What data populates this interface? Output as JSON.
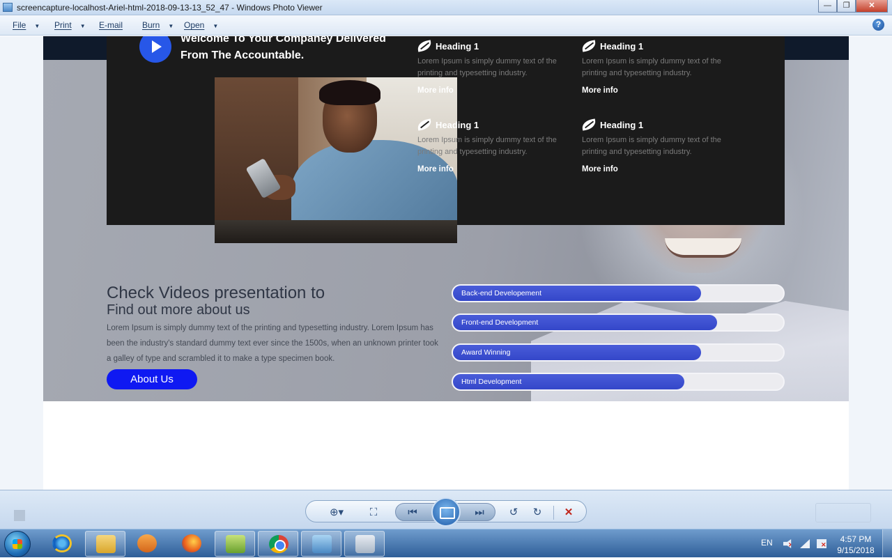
{
  "window": {
    "title": "screencapture-localhost-Ariel-html-2018-09-13-13_52_47 - Windows Photo Viewer",
    "minimize": "—",
    "restore": "❐",
    "close": "✕"
  },
  "menu": {
    "items": [
      "File",
      "Print",
      "E-mail",
      "Burn",
      "Open"
    ],
    "help": "?"
  },
  "webpage": {
    "welcome": "Welcome To Your Companey Delivered From The Accountable.",
    "features": [
      {
        "title": "Heading 1",
        "text": "Lorem Ipsum is simply dummy text of the printing and typesetting industry.",
        "more": "More info"
      },
      {
        "title": "Heading 1",
        "text": "Lorem Ipsum is simply dummy text of the printing and typesetting industry.",
        "more": "More info"
      },
      {
        "title": "Heading 1",
        "text": "Lorem Ipsum is simply dummy text of the printing and typesetting industry.",
        "more": "More info"
      },
      {
        "title": "Heading 1",
        "text": "Lorem Ipsum is simply dummy text of the printing and typesetting industry.",
        "more": "More info"
      }
    ],
    "about": {
      "heading": "Check Videos presentation to",
      "subheading": "Find out more about us",
      "paragraph": "Lorem Ipsum is simply dummy text of the printing and typesetting industry. Lorem Ipsum has been the industry's standard dummy text ever since the 1500s, when an unknown printer took a galley of type and scrambled it to make a type specimen book.",
      "button": "About Us"
    },
    "skills": [
      {
        "label": "Back-end Developement",
        "percent": 75
      },
      {
        "label": "Front-end Development",
        "percent": 80
      },
      {
        "label": "Award Winning",
        "percent": 75
      },
      {
        "label": "Html Development",
        "percent": 70
      }
    ],
    "accent_color": "#2757e8",
    "button_color": "#0f19f2"
  },
  "toolbar": {
    "zoom": "⊕▾",
    "fit": "⛶",
    "previous": "⏮",
    "next": "⏭",
    "rotate_ccw": "↺",
    "rotate_cw": "↻",
    "delete": "✕"
  },
  "taskbar": {
    "language": "EN",
    "time": "4:57 PM",
    "date": "9/15/2018"
  }
}
